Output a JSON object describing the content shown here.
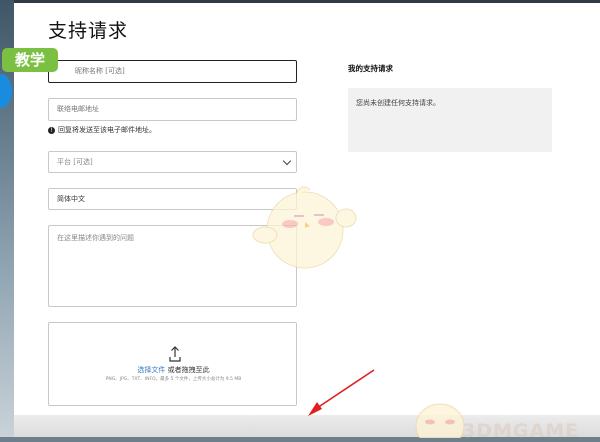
{
  "page": {
    "title": "支持请求",
    "badge": "教学"
  },
  "form": {
    "name_placeholder": "昵称名称 [可选]",
    "email_placeholder": "联络电邮地址",
    "email_note": "回复将发送至该电子邮件地址。",
    "platform_placeholder": "平台 [可选]",
    "language_value": "简体中文",
    "description_placeholder": "在这里描述你遇到的问题",
    "upload": {
      "choose_file": "选择文件",
      "or_drag": "或者拖拽至此",
      "hint": "PNG、JPG、TXT、INFO。最多 5 个文件，上传大小总计为 9.5 MB"
    }
  },
  "sidebar": {
    "title": "我的支持请求",
    "empty_text": "您尚未创建任何支持请求。"
  },
  "watermark": "3DMGAME",
  "colors": {
    "badge_green": "#7bc043",
    "arrow_red": "#e02020",
    "link_blue": "#3a78c2"
  }
}
